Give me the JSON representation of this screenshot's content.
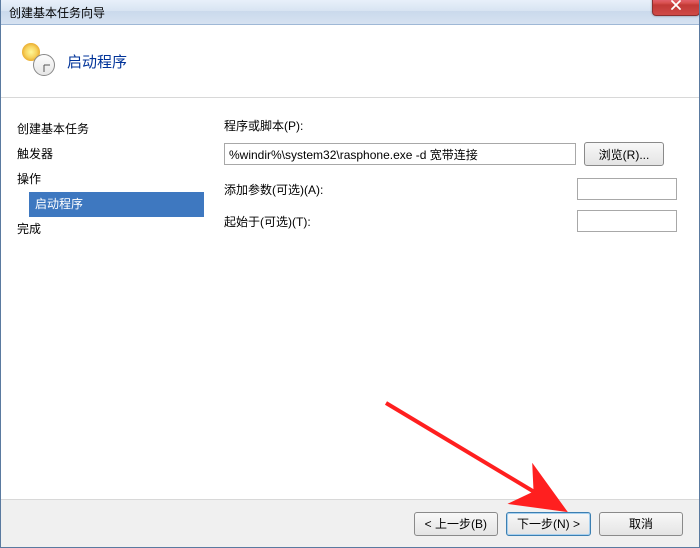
{
  "window": {
    "title": "创建基本任务向导"
  },
  "header": {
    "title": "启动程序"
  },
  "sidebar": {
    "items": [
      {
        "label": "创建基本任务"
      },
      {
        "label": "触发器"
      },
      {
        "label": "操作"
      },
      {
        "label": "启动程序"
      },
      {
        "label": "完成"
      }
    ]
  },
  "content": {
    "program_label": "程序或脚本(P):",
    "program_value": "%windir%\\system32\\rasphone.exe -d 宽带连接",
    "browse_label": "浏览(R)...",
    "args_label": "添加参数(可选)(A):",
    "args_value": "",
    "startin_label": "起始于(可选)(T):",
    "startin_value": ""
  },
  "footer": {
    "back": "< 上一步(B)",
    "next": "下一步(N) >",
    "cancel": "取消"
  }
}
